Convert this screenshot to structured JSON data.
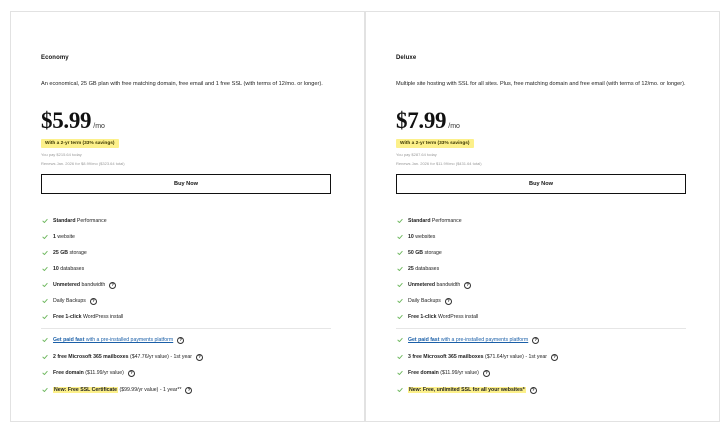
{
  "colors": {
    "accent_check": "#6fb85f",
    "highlight": "#fcf08a",
    "link": "#1a5fa8"
  },
  "plans": [
    {
      "name": "Economy",
      "description": "An economical, 25 GB plan with free matching domain, free email and 1 free SSL (with terms of 12/mo. or longer).",
      "price": "$5.99",
      "per": "/mo",
      "savings": "With a 2-yr term (33% savings)",
      "fine_1": "You pay $215.64 today",
      "fine_2": "Renews Jan. 2026 for $8.99/mo ($323.64 total)",
      "buy_label": "Buy Now",
      "features": [
        {
          "bold": "Standard",
          "text": " Performance",
          "help": false
        },
        {
          "bold": "1",
          "text": " website",
          "help": false
        },
        {
          "bold": "25 GB",
          "text": " storage",
          "help": false
        },
        {
          "bold": "10",
          "text": " databases",
          "help": false
        },
        {
          "bold": "Unmetered",
          "text": " bandwidth",
          "help": true
        },
        {
          "bold": "",
          "text": "Daily Backups",
          "help": true
        },
        {
          "bold": "Free 1-click",
          "text": " WordPress install",
          "help": false
        }
      ],
      "extras": [
        {
          "bold": "Get paid fast",
          "text": " with a pre-installed payments platform",
          "help": true,
          "style": "link"
        },
        {
          "bold": "2 free Microsoft 365 mailboxes",
          "text": " ($47.76/yr value) - 1st year",
          "help": true,
          "style": ""
        },
        {
          "bold": "Free domain",
          "text": " ($11.99/yr value)",
          "help": true,
          "style": ""
        },
        {
          "bold": "New: Free SSL Certificate",
          "text": " ($99.99/yr value) - 1 year**",
          "help": true,
          "style": "hl"
        }
      ]
    },
    {
      "name": "Deluxe",
      "description": "Multiple site hosting with SSL for all sites. Plus, free matching domain and free email (with terms of 12/mo. or longer).",
      "price": "$7.99",
      "per": "/mo",
      "savings": "With a 2-yr term (33% savings)",
      "fine_1": "You pay $287.64 today",
      "fine_2": "Renews Jan. 2026 for $11.99/mo ($431.64 total)",
      "buy_label": "Buy Now",
      "features": [
        {
          "bold": "Standard",
          "text": " Performance",
          "help": false
        },
        {
          "bold": "10",
          "text": " websites",
          "help": false
        },
        {
          "bold": "50 GB",
          "text": " storage",
          "help": false
        },
        {
          "bold": "25",
          "text": " databases",
          "help": false
        },
        {
          "bold": "Unmetered",
          "text": " bandwidth",
          "help": true
        },
        {
          "bold": "",
          "text": "Daily Backups",
          "help": true
        },
        {
          "bold": "Free 1-click",
          "text": " WordPress install",
          "help": false
        }
      ],
      "extras": [
        {
          "bold": "Get paid fast",
          "text": " with a pre-installed payments platform",
          "help": true,
          "style": "link"
        },
        {
          "bold": "3 free Microsoft 365 mailboxes",
          "text": " ($71.64/yr value) - 1st year",
          "help": true,
          "style": ""
        },
        {
          "bold": "Free domain",
          "text": " ($11.99/yr value)",
          "help": true,
          "style": ""
        },
        {
          "bold": "New: Free, unlimited SSL for all your websites*",
          "text": "",
          "help": true,
          "style": "hl"
        }
      ]
    }
  ]
}
